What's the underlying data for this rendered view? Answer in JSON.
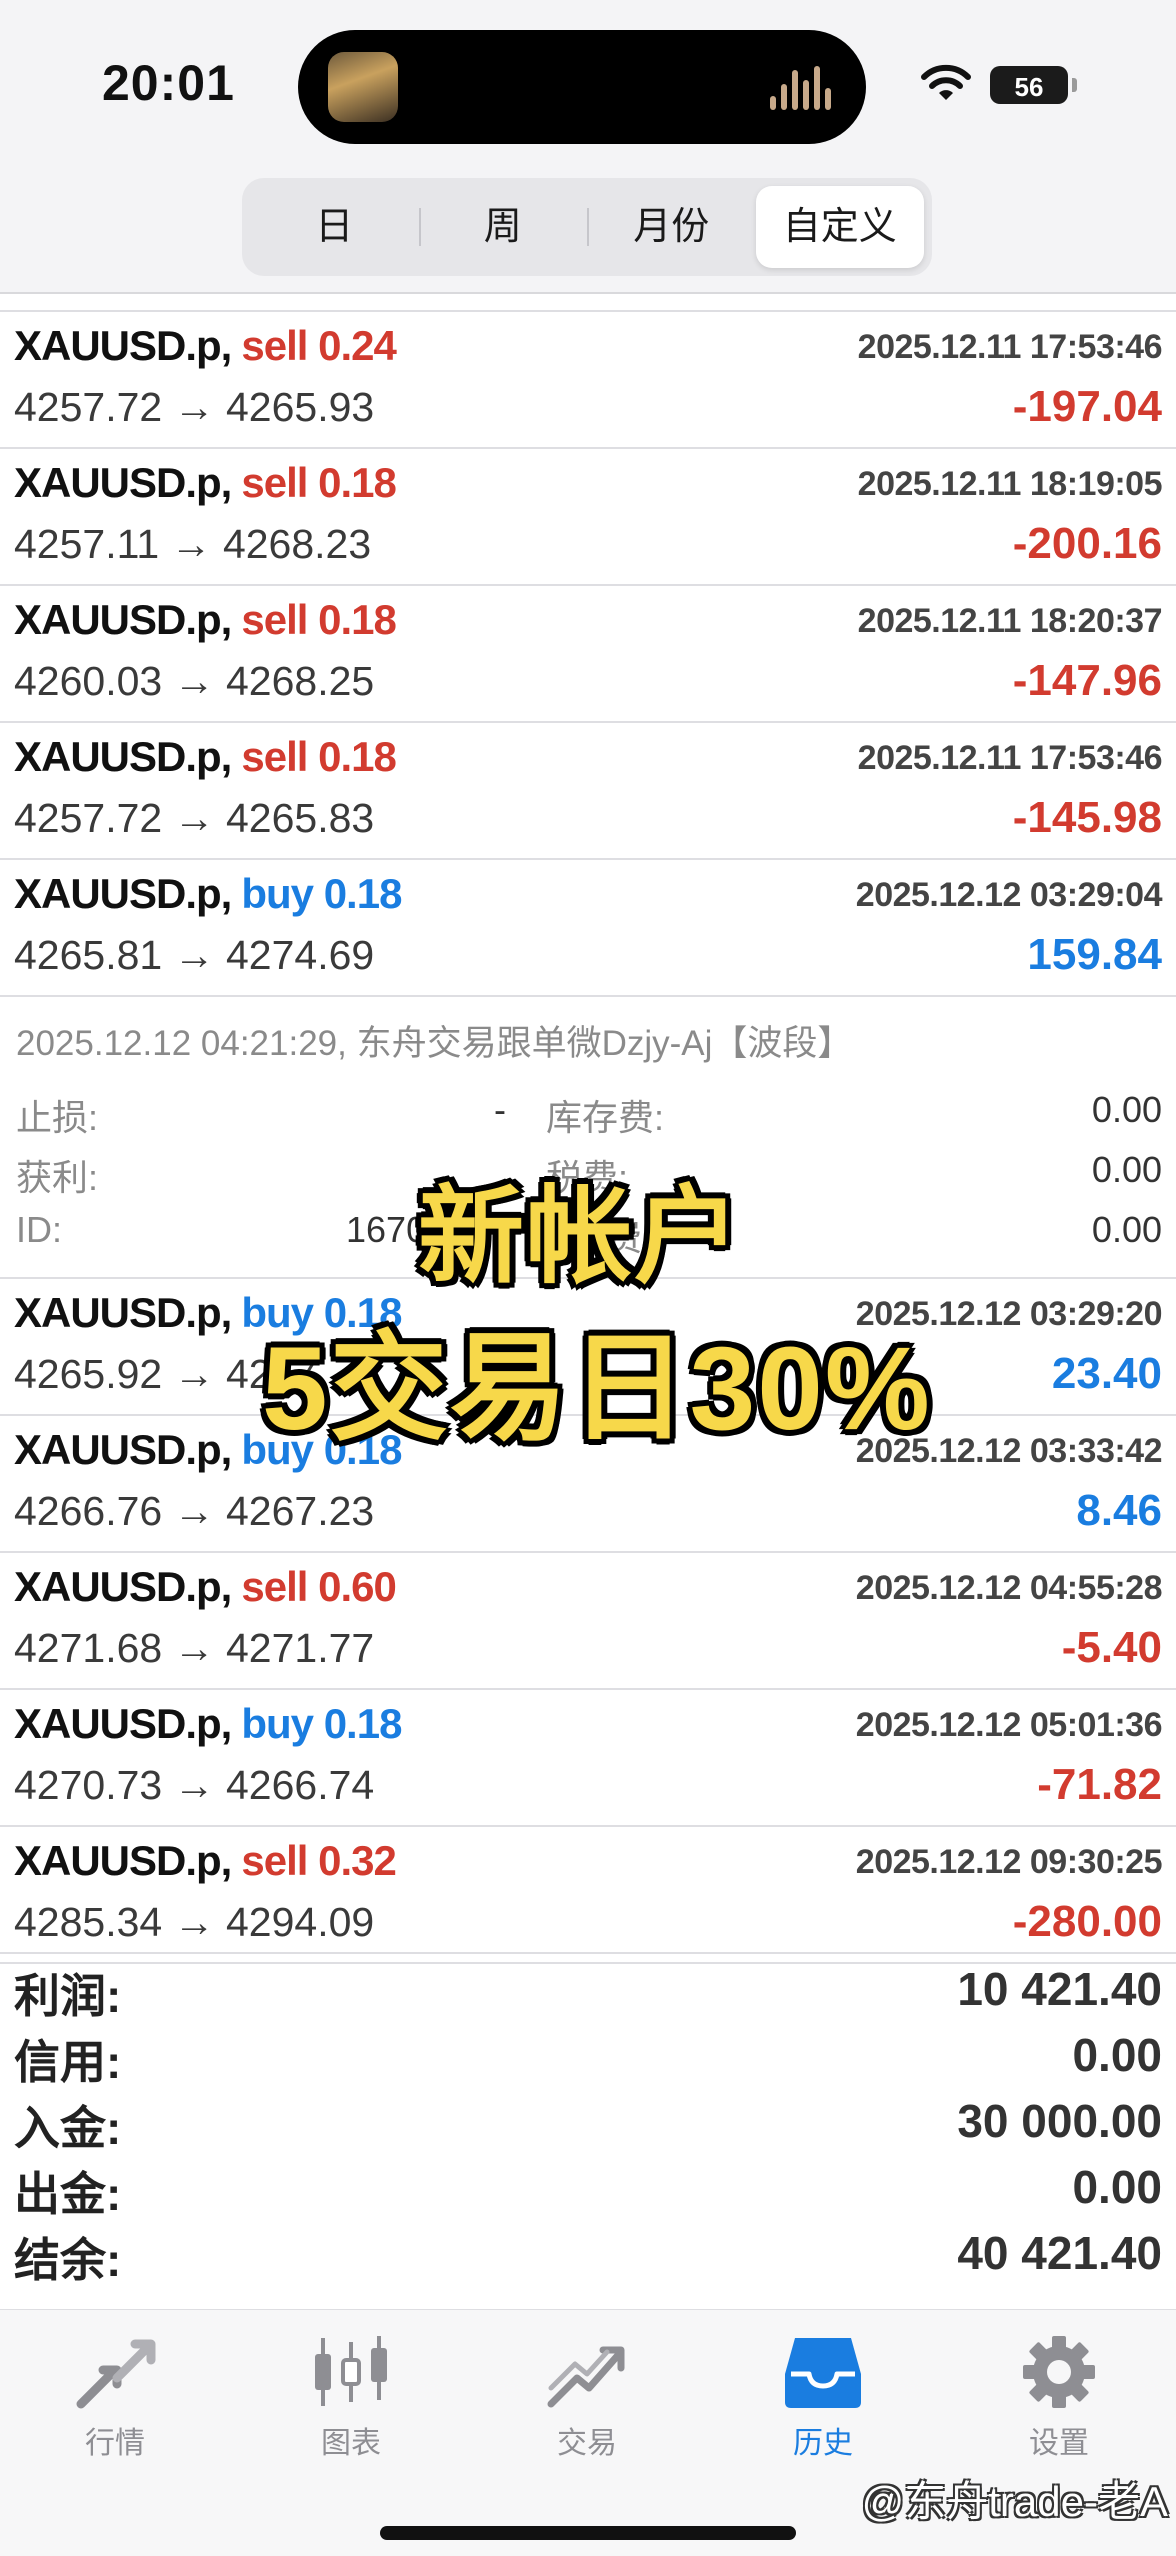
{
  "status": {
    "time": "20:01",
    "battery": "56"
  },
  "period_tabs": [
    {
      "label": "日"
    },
    {
      "label": "周"
    },
    {
      "label": "月份"
    },
    {
      "label": "自定义"
    }
  ],
  "trades_before": [
    {
      "symbol": "XAUUSD.p,",
      "side": "sell",
      "volume": "0.24",
      "datetime": "2025.12.11 17:53:46",
      "prices": "4257.72 → 4265.93",
      "profit": "-197.04"
    },
    {
      "symbol": "XAUUSD.p,",
      "side": "sell",
      "volume": "0.18",
      "datetime": "2025.12.11 18:19:05",
      "prices": "4257.11 → 4268.23",
      "profit": "-200.16"
    },
    {
      "symbol": "XAUUSD.p,",
      "side": "sell",
      "volume": "0.18",
      "datetime": "2025.12.11 18:20:37",
      "prices": "4260.03 → 4268.25",
      "profit": "-147.96"
    },
    {
      "symbol": "XAUUSD.p,",
      "side": "sell",
      "volume": "0.18",
      "datetime": "2025.12.11 17:53:46",
      "prices": "4257.72 → 4265.83",
      "profit": "-145.98"
    },
    {
      "symbol": "XAUUSD.p,",
      "side": "buy",
      "volume": "0.18",
      "datetime": "2025.12.12 03:29:04",
      "prices": "4265.81 → 4274.69",
      "profit": "159.84"
    }
  ],
  "detail": {
    "comment": "2025.12.12 04:21:29, 东舟交易跟单微Dzjy-Aj【波段】",
    "stop_loss_label": "止损:",
    "stop_loss_value": "-",
    "take_profit_label": "获利:",
    "swap_label": "库存费:",
    "swap_value": "0.00",
    "tax_label": "税费:",
    "tax_value": "0.00",
    "id_label": "ID:",
    "id_value": "1670",
    "fee_label": "费",
    "fee_value": "0.00"
  },
  "trades_after": [
    {
      "symbol": "XAUUSD.p,",
      "side": "buy",
      "volume": "0.18",
      "datetime": "2025.12.12 03:29:20",
      "prices": "4265.92 → 4267",
      "profit": "23.40"
    },
    {
      "symbol": "XAUUSD.p,",
      "side": "buy",
      "volume": "0.18",
      "datetime": "2025.12.12 03:33:42",
      "prices": "4266.76 → 4267.23",
      "profit": "8.46"
    },
    {
      "symbol": "XAUUSD.p,",
      "side": "sell",
      "volume": "0.60",
      "datetime": "2025.12.12 04:55:28",
      "prices": "4271.68 → 4271.77",
      "profit": "-5.40"
    },
    {
      "symbol": "XAUUSD.p,",
      "side": "buy",
      "volume": "0.18",
      "datetime": "2025.12.12 05:01:36",
      "prices": "4270.73 → 4266.74",
      "profit": "-71.82"
    },
    {
      "symbol": "XAUUSD.p,",
      "side": "sell",
      "volume": "0.32",
      "datetime": "2025.12.12 09:30:25",
      "prices": "4285.34 → 4294.09",
      "profit": "-280.00"
    }
  ],
  "overlay": {
    "line1": "新帐户",
    "line2": "5交易日30%"
  },
  "summary": [
    {
      "label": "利润:",
      "value": "10 421.40"
    },
    {
      "label": "信用:",
      "value": "0.00"
    },
    {
      "label": "入金:",
      "value": "30 000.00"
    },
    {
      "label": "出金:",
      "value": "0.00"
    },
    {
      "label": "结余:",
      "value": "40 421.40"
    }
  ],
  "tabbar": [
    {
      "label": "行情",
      "icon": "quotes-arrows-icon"
    },
    {
      "label": "图表",
      "icon": "candlestick-chart-icon"
    },
    {
      "label": "交易",
      "icon": "trade-trend-icon"
    },
    {
      "label": "历史",
      "icon": "history-inbox-icon",
      "active": true
    },
    {
      "label": "设置",
      "icon": "gear-icon"
    }
  ],
  "watermark": "@东舟trade-老A",
  "colors": {
    "sell": "#d23b2f",
    "buy": "#1a7de0",
    "active_tab": "#1a7de0",
    "overlay_text": "#f7d84a"
  }
}
